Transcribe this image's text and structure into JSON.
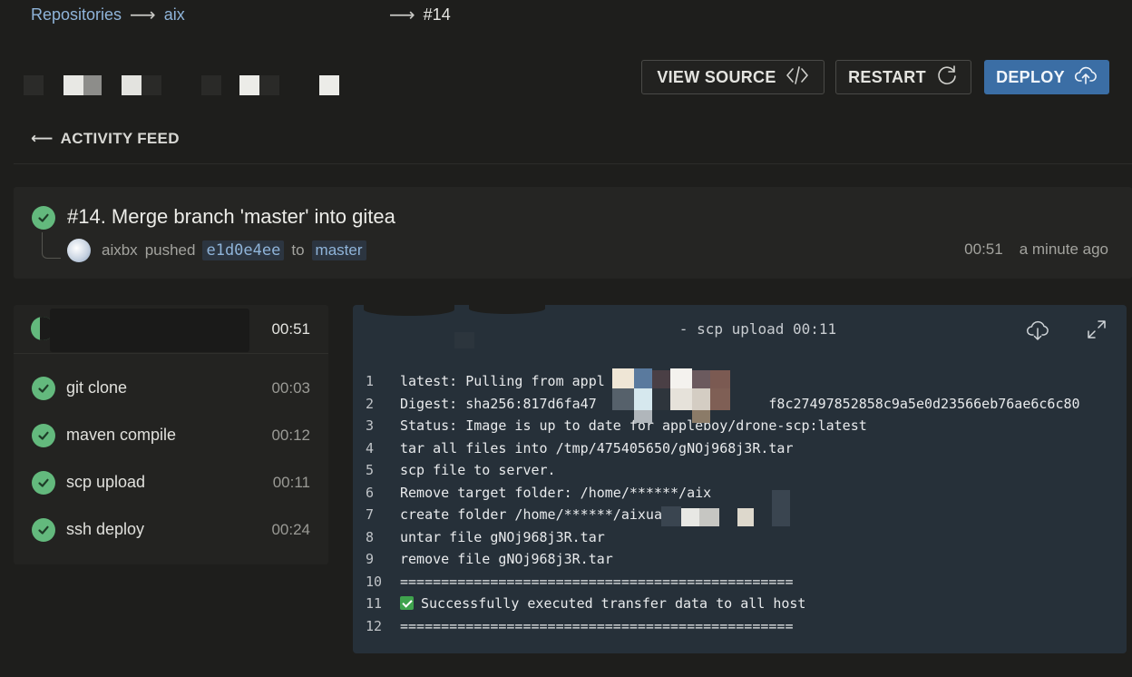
{
  "breadcrumb": {
    "repositories": "Repositories",
    "repo": "aix",
    "build": "#14"
  },
  "actions": {
    "view_source": "VIEW SOURCE",
    "restart": "RESTART",
    "deploy": "DEPLOY"
  },
  "back_label": "ACTIVITY FEED",
  "build": {
    "title": "#14. Merge branch 'master' into gitea",
    "author": "aixbx",
    "verb": "pushed",
    "commit": "e1d0e4ee",
    "to_word": "to",
    "branch": "master",
    "duration": "00:51",
    "relative_time": "a minute ago"
  },
  "steps_panel": {
    "total_duration": "00:51",
    "steps": [
      {
        "name": "git clone",
        "duration": "00:03",
        "status": "success"
      },
      {
        "name": "maven compile",
        "duration": "00:12",
        "status": "success"
      },
      {
        "name": "scp upload",
        "duration": "00:11",
        "status": "success"
      },
      {
        "name": "ssh deploy",
        "duration": "00:24",
        "status": "success"
      }
    ]
  },
  "log": {
    "title": "- scp upload 00:11",
    "lines": [
      {
        "n": "1",
        "text": "latest: Pulling from appl"
      },
      {
        "n": "2",
        "text": "Digest: sha256:817d6fa47                     f8c27497852858c9a5e0d23566eb76ae6c6c80"
      },
      {
        "n": "3",
        "text": "Status: Image is up to date for appleboy/drone-scp:latest"
      },
      {
        "n": "4",
        "text": "tar all files into /tmp/475405650/gNOj968j3R.tar"
      },
      {
        "n": "5",
        "text": "scp file to server."
      },
      {
        "n": "6",
        "text": "Remove target folder: /home/******/aix"
      },
      {
        "n": "7",
        "text": "create folder /home/******/aixua"
      },
      {
        "n": "8",
        "text": "untar file gNOj968j3R.tar"
      },
      {
        "n": "9",
        "text": "remove file gNOj968j3R.tar"
      },
      {
        "n": "10",
        "text": "================================================"
      },
      {
        "n": "11",
        "text": "Successfully executed transfer data to all host"
      },
      {
        "n": "12",
        "text": "================================================"
      }
    ]
  },
  "colors": {
    "background": "#1e1e1c",
    "accent": "#3b6ea5",
    "link": "#8fb4d9",
    "success": "#63b97d",
    "log_bg": "#263039"
  }
}
